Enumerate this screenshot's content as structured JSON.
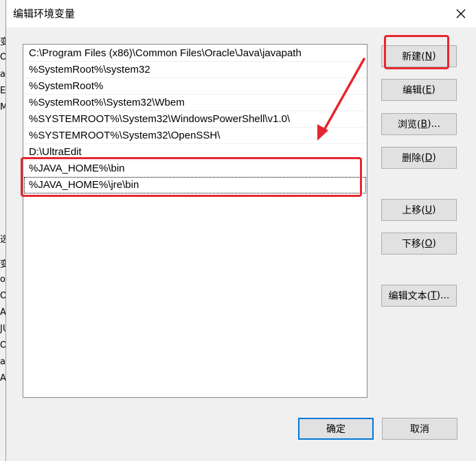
{
  "background_window": {
    "fragments": [
      "变",
      "Or",
      "a",
      "E",
      "M",
      "选",
      "变",
      "o",
      "Or",
      "A",
      "JU",
      "O",
      "a",
      "A"
    ]
  },
  "dialog": {
    "title": "编辑环境变量",
    "close_icon": "close-icon",
    "path_entries": [
      "C:\\Program Files (x86)\\Common Files\\Oracle\\Java\\javapath",
      "%SystemRoot%\\system32",
      "%SystemRoot%",
      "%SystemRoot%\\System32\\Wbem",
      "%SYSTEMROOT%\\System32\\WindowsPowerShell\\v1.0\\",
      "%SYSTEMROOT%\\System32\\OpenSSH\\",
      "D:\\UltraEdit",
      "%JAVA_HOME%\\bin",
      "%JAVA_HOME%\\jre\\bin"
    ],
    "buttons": {
      "new": {
        "label": "新建(",
        "key": "N",
        "suffix": ")"
      },
      "edit": {
        "label": "编辑(",
        "key": "E",
        "suffix": ")"
      },
      "browse": {
        "label": "浏览(",
        "key": "B",
        "suffix": ")..."
      },
      "delete": {
        "label": "删除(",
        "key": "D",
        "suffix": ")"
      },
      "move_up": {
        "label": "上移(",
        "key": "U",
        "suffix": ")"
      },
      "move_down": {
        "label": "下移(",
        "key": "O",
        "suffix": ")"
      },
      "edit_text": {
        "label": "编辑文本(",
        "key": "T",
        "suffix": ")..."
      },
      "ok": "确定",
      "cancel": "取消"
    }
  },
  "annotation_color": "#e6262e"
}
